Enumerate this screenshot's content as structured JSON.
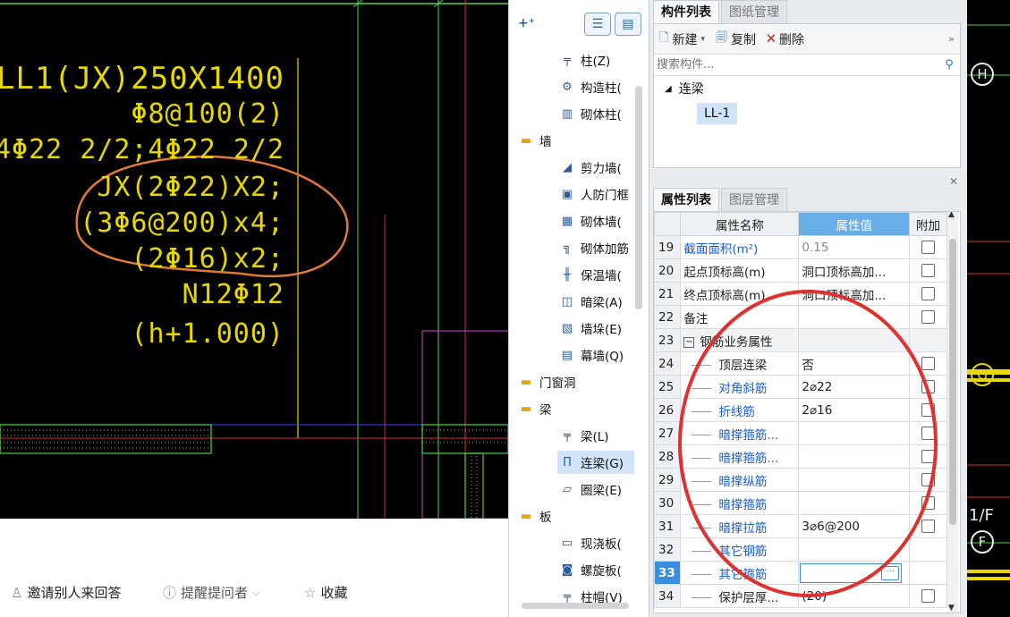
{
  "cad_annotation": {
    "line1": "LL1(JX)250X1400",
    "line2": "Φ8@100(2)",
    "line3": "4Φ22 2/2;4Φ22 2/2",
    "line4": "JX(2Φ22)X2;",
    "line5": "(3Φ6@200)x4;",
    "line6": "(2Φ16)x2;",
    "line7": "N12Φ12",
    "line8": "(h+1.000)"
  },
  "footer": {
    "invite": "邀请别人来回答",
    "remind": "提醒提问者",
    "favorite": "收藏"
  },
  "nav_tree": {
    "items": [
      {
        "label": "柱(Z)",
        "icon": "column-icon"
      },
      {
        "label": "构造柱(",
        "icon": "constructional-column-icon"
      },
      {
        "label": "砌体柱(",
        "icon": "masonry-column-icon"
      },
      {
        "label": "墙",
        "icon": "folder-icon",
        "group": true
      },
      {
        "label": "剪力墙(",
        "icon": "shear-wall-icon"
      },
      {
        "label": "人防门框",
        "icon": "civil-defense-door-icon"
      },
      {
        "label": "砌体墙(",
        "icon": "masonry-wall-icon"
      },
      {
        "label": "砌体加筋",
        "icon": "masonry-rebar-icon"
      },
      {
        "label": "保温墙(",
        "icon": "insulation-wall-icon"
      },
      {
        "label": "暗梁(A)",
        "icon": "hidden-beam-icon"
      },
      {
        "label": "墙垛(E)",
        "icon": "wall-pier-icon"
      },
      {
        "label": "幕墙(Q)",
        "icon": "curtain-wall-icon"
      },
      {
        "label": "门窗洞",
        "icon": "folder-icon",
        "group": true
      },
      {
        "label": "梁",
        "icon": "folder-icon",
        "group": true
      },
      {
        "label": "梁(L)",
        "icon": "beam-icon"
      },
      {
        "label": "连梁(G)",
        "icon": "coupling-beam-icon",
        "selected": true
      },
      {
        "label": "圈梁(E)",
        "icon": "ring-beam-icon"
      },
      {
        "label": "板",
        "icon": "folder-icon",
        "group": true
      },
      {
        "label": "现浇板(",
        "icon": "cast-slab-icon"
      },
      {
        "label": "螺旋板(",
        "icon": "spiral-slab-icon"
      },
      {
        "label": "柱帽(V)",
        "icon": "column-cap-icon"
      }
    ]
  },
  "component_panel": {
    "tabs": [
      "构件列表",
      "图纸管理"
    ],
    "toolbar": {
      "new": "新建",
      "copy": "复制",
      "delete": "删除"
    },
    "search_placeholder": "搜索构件...",
    "tree": {
      "group": "连梁",
      "item": "LL-1"
    }
  },
  "attr_panel": {
    "tabs": [
      "属性列表",
      "图层管理"
    ],
    "headers": {
      "name": "属性名称",
      "value": "属性值",
      "extra": "附加"
    },
    "rows": [
      {
        "num": "19",
        "name": "截面面积(m²)",
        "value": "0.15",
        "blue": true,
        "grey": true,
        "check": true
      },
      {
        "num": "20",
        "name": "起点顶标高(m)",
        "value": "洞口顶标高加...",
        "check": true
      },
      {
        "num": "21",
        "name": "终点顶标高(m)",
        "value": "洞口顶标高加...",
        "check": true
      },
      {
        "num": "22",
        "name": "备注",
        "value": "",
        "check": true
      },
      {
        "num": "23",
        "name": "钢筋业务属性",
        "value": "",
        "group": true,
        "check": false
      },
      {
        "num": "24",
        "name": "顶层连梁",
        "value": "否",
        "child": true,
        "check": true
      },
      {
        "num": "25",
        "name": "对角斜筋",
        "value": "2⌀22",
        "child": true,
        "blue": true,
        "check": true
      },
      {
        "num": "26",
        "name": "折线筋",
        "value": "2⌀16",
        "child": true,
        "blue": true,
        "check": true
      },
      {
        "num": "27",
        "name": "暗撑箍筋...",
        "value": "",
        "child": true,
        "blue": true,
        "check": true
      },
      {
        "num": "28",
        "name": "暗撑箍筋...",
        "value": "",
        "child": true,
        "blue": true,
        "check": true
      },
      {
        "num": "29",
        "name": "暗撑纵筋",
        "value": "",
        "child": true,
        "blue": true,
        "check": true
      },
      {
        "num": "30",
        "name": "暗撑箍筋",
        "value": "",
        "child": true,
        "blue": true,
        "check": true
      },
      {
        "num": "31",
        "name": "暗撑拉筋",
        "value": "3⌀6@200",
        "child": true,
        "blue": true,
        "check": true
      },
      {
        "num": "32",
        "name": "其它钢筋",
        "value": "",
        "child": true,
        "blue": true,
        "check": false
      },
      {
        "num": "33",
        "name": "其它箍筋",
        "value": "",
        "child": true,
        "blue": true,
        "editing": true,
        "check": false
      },
      {
        "num": "34",
        "name": "保护层厚...",
        "value": "(20)",
        "child": true,
        "check": true
      }
    ]
  },
  "right_axis": {
    "h": "H",
    "g": "G",
    "f_label": "1/F",
    "f": "F"
  },
  "colors": {
    "cad_yellow": "#e6d800",
    "highlight_red": "#e03030",
    "annot_orange": "#e07a3a",
    "accent_blue": "#3b8de0"
  }
}
